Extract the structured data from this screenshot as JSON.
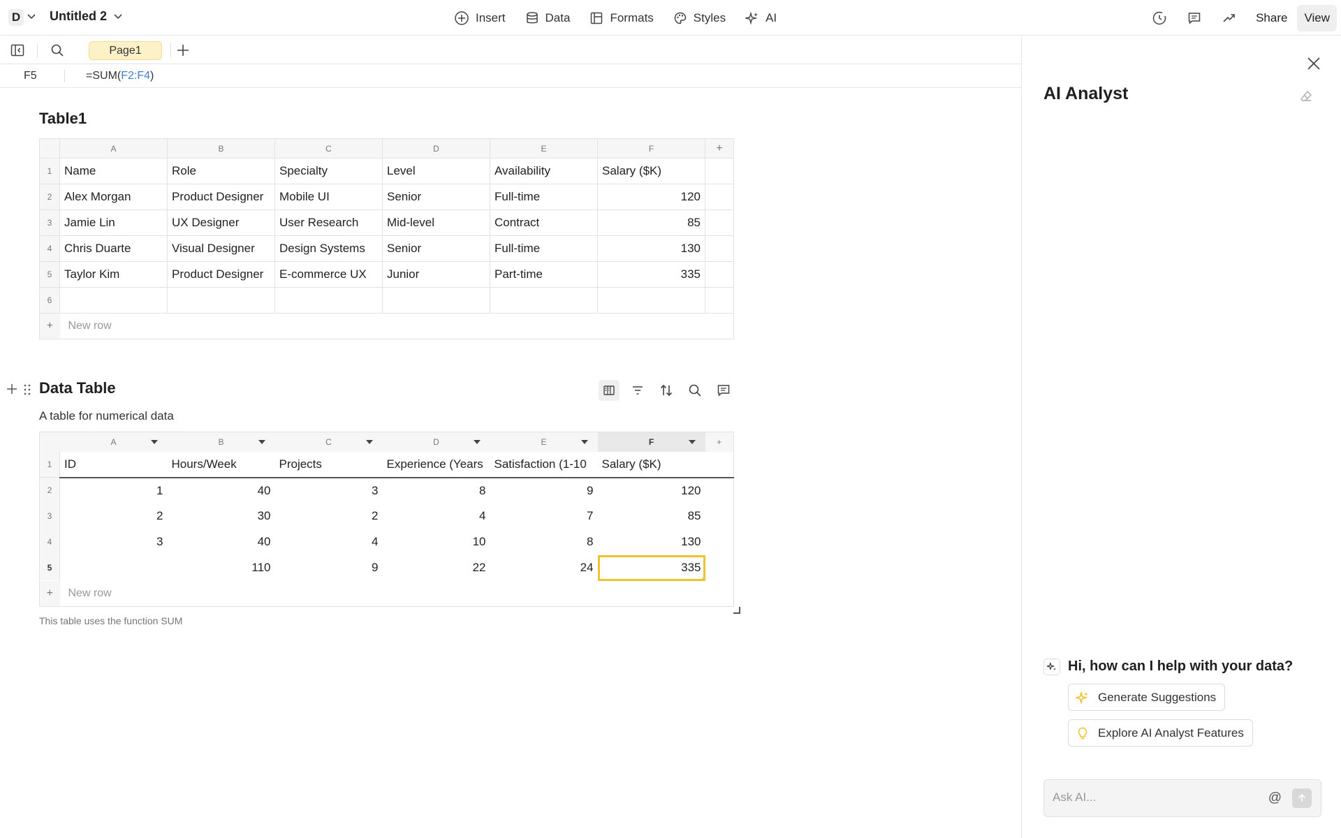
{
  "topbar": {
    "workspace_initial": "D",
    "doc_title": "Untitled 2",
    "menu": [
      {
        "label": "Insert",
        "icon": "plus-circle-icon"
      },
      {
        "label": "Data",
        "icon": "database-icon"
      },
      {
        "label": "Formats",
        "icon": "formats-icon"
      },
      {
        "label": "Styles",
        "icon": "palette-icon"
      },
      {
        "label": "AI",
        "icon": "sparkle-icon"
      }
    ],
    "share_label": "Share",
    "view_label": "View"
  },
  "toolbar": {
    "page_tab": "Page1"
  },
  "formula_bar": {
    "cell_ref": "F5",
    "formula_prefix": "=SUM(",
    "formula_range": "F2:F4",
    "formula_suffix": ")"
  },
  "table1": {
    "title": "Table1",
    "columns": [
      "A",
      "B",
      "C",
      "D",
      "E",
      "F"
    ],
    "rows": [
      {
        "n": "1",
        "cells": [
          "Name",
          "Role",
          "Specialty",
          "Level",
          "Availability",
          "Salary ($K)"
        ]
      },
      {
        "n": "2",
        "cells": [
          "Alex Morgan",
          "Product Designer",
          "Mobile UI",
          "Senior",
          "Full-time",
          "120"
        ]
      },
      {
        "n": "3",
        "cells": [
          "Jamie Lin",
          "UX Designer",
          "User Research",
          "Mid-level",
          "Contract",
          "85"
        ]
      },
      {
        "n": "4",
        "cells": [
          "Chris Duarte",
          "Visual Designer",
          "Design Systems",
          "Senior",
          "Full-time",
          "130"
        ]
      },
      {
        "n": "5",
        "cells": [
          "Taylor Kim",
          "Product Designer",
          "E-commerce UX",
          "Junior",
          "Part-time",
          "335"
        ]
      },
      {
        "n": "6",
        "cells": [
          "",
          "",
          "",
          "",
          "",
          ""
        ]
      }
    ],
    "new_row_label": "New row",
    "add_plus": "+"
  },
  "data_table": {
    "title": "Data Table",
    "subtitle": "A table for numerical data",
    "columns": [
      "A",
      "B",
      "C",
      "D",
      "E",
      "F"
    ],
    "headers": [
      "ID",
      "Hours/Week",
      "Projects",
      "Experience (Years",
      "Satisfaction (1-10",
      "Salary ($K)"
    ],
    "rows": [
      {
        "n": "2",
        "cells": [
          "1",
          "40",
          "3",
          "8",
          "9",
          "120"
        ]
      },
      {
        "n": "3",
        "cells": [
          "2",
          "30",
          "2",
          "4",
          "7",
          "85"
        ]
      },
      {
        "n": "4",
        "cells": [
          "3",
          "40",
          "4",
          "10",
          "8",
          "130"
        ]
      },
      {
        "n": "5",
        "cells": [
          "",
          "110",
          "9",
          "22",
          "24",
          "335"
        ]
      }
    ],
    "header_row_number": "1",
    "new_row_label": "New row",
    "add_plus": "+",
    "caption": "This table uses the function SUM",
    "selected_cell": "F5"
  },
  "panel": {
    "title": "AI Analyst",
    "greeting": "Hi, how can I help with your data?",
    "suggestions": [
      {
        "label": "Generate Suggestions",
        "icon": "sparkle-icon"
      },
      {
        "label": "Explore AI Analyst Features",
        "icon": "lightbulb-icon"
      }
    ],
    "ask_placeholder": "Ask AI...",
    "mention_symbol": "@"
  },
  "colors": {
    "accent_yellow": "#f3c230",
    "page_tab_bg": "#fdf1c7",
    "formula_ref": "#3f7fd2"
  }
}
